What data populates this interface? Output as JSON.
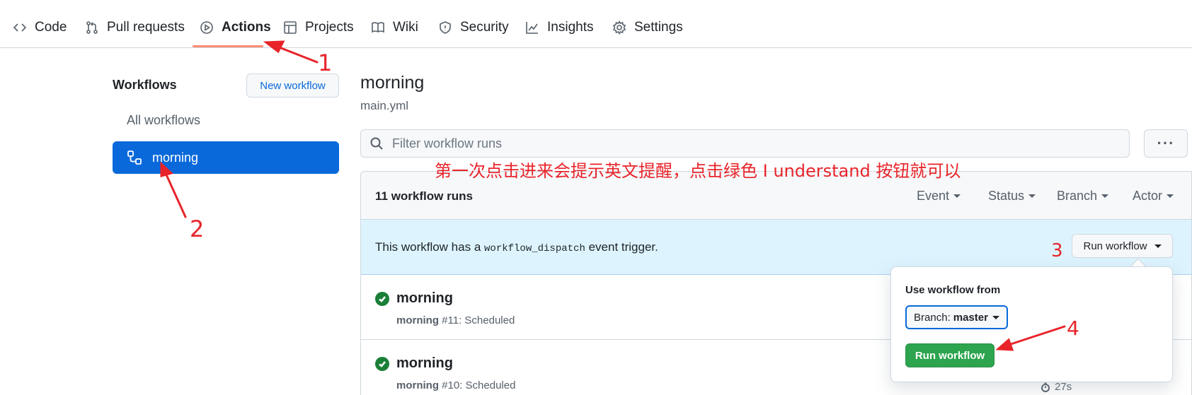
{
  "nav": {
    "tabs": [
      {
        "label": "Code",
        "icon": "code-icon"
      },
      {
        "label": "Pull requests",
        "icon": "pull-request-icon"
      },
      {
        "label": "Actions",
        "icon": "play-icon"
      },
      {
        "label": "Projects",
        "icon": "table-icon"
      },
      {
        "label": "Wiki",
        "icon": "book-icon"
      },
      {
        "label": "Security",
        "icon": "shield-icon"
      },
      {
        "label": "Insights",
        "icon": "graph-icon"
      },
      {
        "label": "Settings",
        "icon": "gear-icon"
      }
    ],
    "active": "Actions"
  },
  "sidebar": {
    "title": "Workflows",
    "new_workflow": "New workflow",
    "all_workflows": "All workflows",
    "active_item": "morning"
  },
  "main": {
    "title": "morning",
    "file": "main.yml",
    "filter_placeholder": "Filter workflow runs",
    "more": "···",
    "runs_count": "11 workflow runs",
    "filters": [
      "Event",
      "Status",
      "Branch",
      "Actor"
    ],
    "dispatch": {
      "prefix": "This workflow has a",
      "code": "workflow_dispatch",
      "suffix": "event trigger.",
      "button": "Run workflow"
    },
    "runs": [
      {
        "title": "morning",
        "workflow": "morning",
        "number": "#11",
        "event": ": Scheduled",
        "duration": ""
      },
      {
        "title": "morning",
        "workflow": "morning",
        "number": "#10",
        "event": ": Scheduled",
        "duration": "27s"
      }
    ]
  },
  "popover": {
    "label": "Use workflow from",
    "branch_prefix": "Branch:",
    "branch": "master",
    "run_button": "Run workflow"
  },
  "annotations": {
    "note": "第一次点击进来会提示英文提醒，点击绿色 I understand 按钮就可以",
    "n1": "1",
    "n2": "2",
    "n3": "3",
    "n4": "4"
  },
  "colors": {
    "accent": "#0969da",
    "success": "#1a7f37",
    "annotation": "#e8242a",
    "tab_underline": "#fd8c73"
  }
}
